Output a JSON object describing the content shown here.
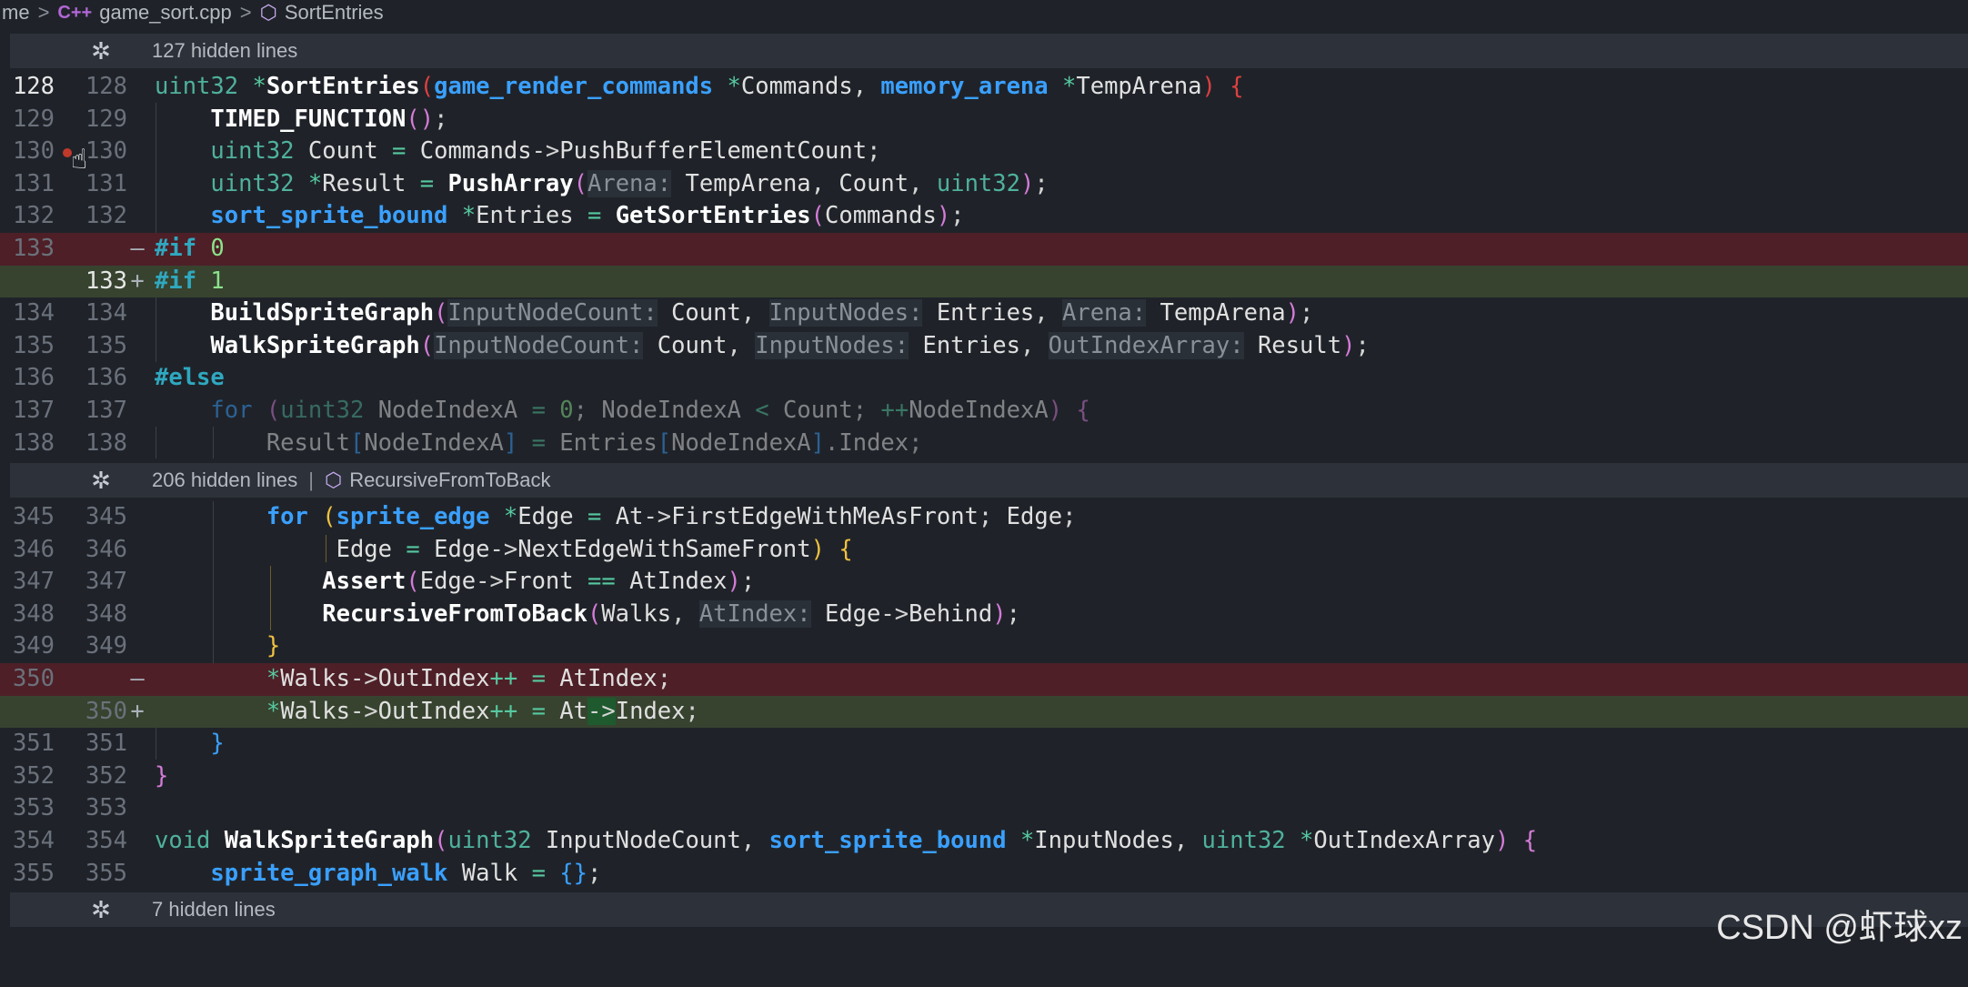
{
  "breadcrumb": {
    "root": "me",
    "lang_icon": "C++",
    "file": "game_sort.cpp",
    "symbol": "SortEntries"
  },
  "folds": [
    {
      "label": "127 hidden lines",
      "symbol": ""
    },
    {
      "label": "206 hidden lines",
      "symbol": "RecursiveFromToBack"
    },
    {
      "label": "7 hidden lines",
      "symbol": ""
    }
  ],
  "gutter": {
    "l128a": "128",
    "l128b": "128",
    "l129a": "129",
    "l129b": "129",
    "l130a": "130",
    "l130b": "130",
    "l131a": "131",
    "l131b": "131",
    "l132a": "132",
    "l132b": "132",
    "l133del": "133",
    "l133add": "133",
    "l134a": "134",
    "l134b": "134",
    "l135a": "135",
    "l135b": "135",
    "l136a": "136",
    "l136b": "136",
    "l137a": "137",
    "l137b": "137",
    "l138a": "138",
    "l138b": "138",
    "l345a": "345",
    "l345b": "345",
    "l346a": "346",
    "l346b": "346",
    "l347a": "347",
    "l347b": "347",
    "l348a": "348",
    "l348b": "348",
    "l349a": "349",
    "l349b": "349",
    "l350del": "350",
    "l350add": "350",
    "l351a": "351",
    "l351b": "351",
    "l352a": "352",
    "l352b": "352",
    "l353a": "353",
    "l353b": "353",
    "l354a": "354",
    "l354b": "354",
    "l355a": "355",
    "l355b": "355",
    "minus": "—",
    "plus": "+"
  },
  "watermark": "CSDN @虾球xz",
  "colors": {
    "deleted_line": "#4e1f27",
    "added_line": "#37432f",
    "background": "#1f2329"
  }
}
